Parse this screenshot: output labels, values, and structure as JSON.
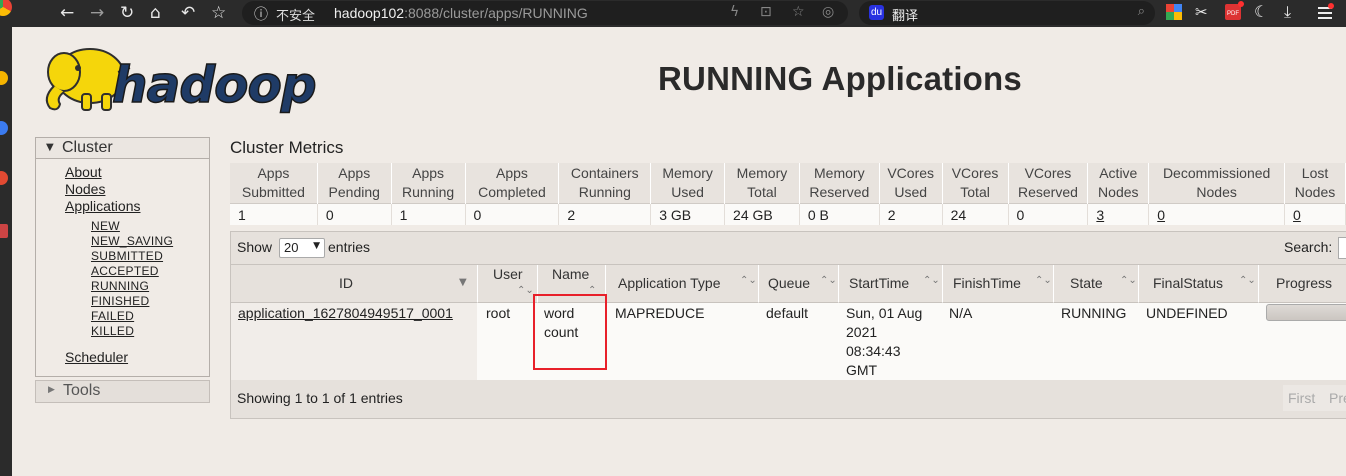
{
  "browser": {
    "insecure_label": "不安全",
    "url_host": "hadoop102",
    "url_rest": ":8088/cluster/apps/RUNNING",
    "search_label": "翻译",
    "search_badge": "du",
    "pdf_badge": "PDF"
  },
  "page": {
    "title": "RUNNING Applications",
    "logo_text": "hadoop"
  },
  "nav": {
    "cluster_label": "Cluster",
    "links": {
      "about": "About",
      "nodes": "Nodes",
      "applications": "Applications",
      "scheduler": "Scheduler"
    },
    "states": [
      "NEW",
      "NEW_SAVING",
      "SUBMITTED",
      "ACCEPTED",
      "RUNNING",
      "FINISHED",
      "FAILED",
      "KILLED"
    ],
    "tools_label": "Tools"
  },
  "metrics": {
    "title": "Cluster Metrics",
    "headers": [
      [
        "Apps",
        "Submitted"
      ],
      [
        "Apps",
        "Pending"
      ],
      [
        "Apps",
        "Running"
      ],
      [
        "Apps",
        "Completed"
      ],
      [
        "Containers",
        "Running"
      ],
      [
        "Memory",
        "Used"
      ],
      [
        "Memory",
        "Total"
      ],
      [
        "Memory",
        "Reserved"
      ],
      [
        "VCores",
        "Used"
      ],
      [
        "VCores",
        "Total"
      ],
      [
        "VCores",
        "Reserved"
      ],
      [
        "Active",
        "Nodes"
      ],
      [
        "Decommissioned",
        "Nodes"
      ],
      [
        "Lost",
        "Nodes"
      ]
    ],
    "values": [
      "1",
      "0",
      "1",
      "0",
      "2",
      "3 GB",
      "24 GB",
      "0 B",
      "2",
      "24",
      "0",
      "3",
      "0",
      "0"
    ]
  },
  "apps": {
    "show_label": "Show",
    "page_size": "20",
    "entries_label": "entries",
    "search_label": "Search:",
    "columns": {
      "id": "ID",
      "user": "User",
      "name": "Name",
      "type": "Application Type",
      "queue": "Queue",
      "start": "StartTime",
      "finish": "FinishTime",
      "state": "State",
      "final": "FinalStatus",
      "progress": "Progress"
    },
    "rows": [
      {
        "id": "application_1627804949517_0001",
        "user": "root",
        "name_1": "word",
        "name_2": "count",
        "type": "MAPREDUCE",
        "queue": "default",
        "start_1": "Sun, 01 Aug",
        "start_2": "2021",
        "start_3": "08:34:43",
        "start_4": "GMT",
        "finish": "N/A",
        "state": "RUNNING",
        "final": "UNDEFINED"
      }
    ],
    "footer_info": "Showing 1 to 1 of 1 entries",
    "first_label": "First",
    "prev_label": "Pre"
  },
  "colors": {
    "page_bg": "#f0ebe6",
    "highlight_box": "#e8202a",
    "logo_yellow": "#f5d60b",
    "logo_dark": "#2f2f2f"
  }
}
